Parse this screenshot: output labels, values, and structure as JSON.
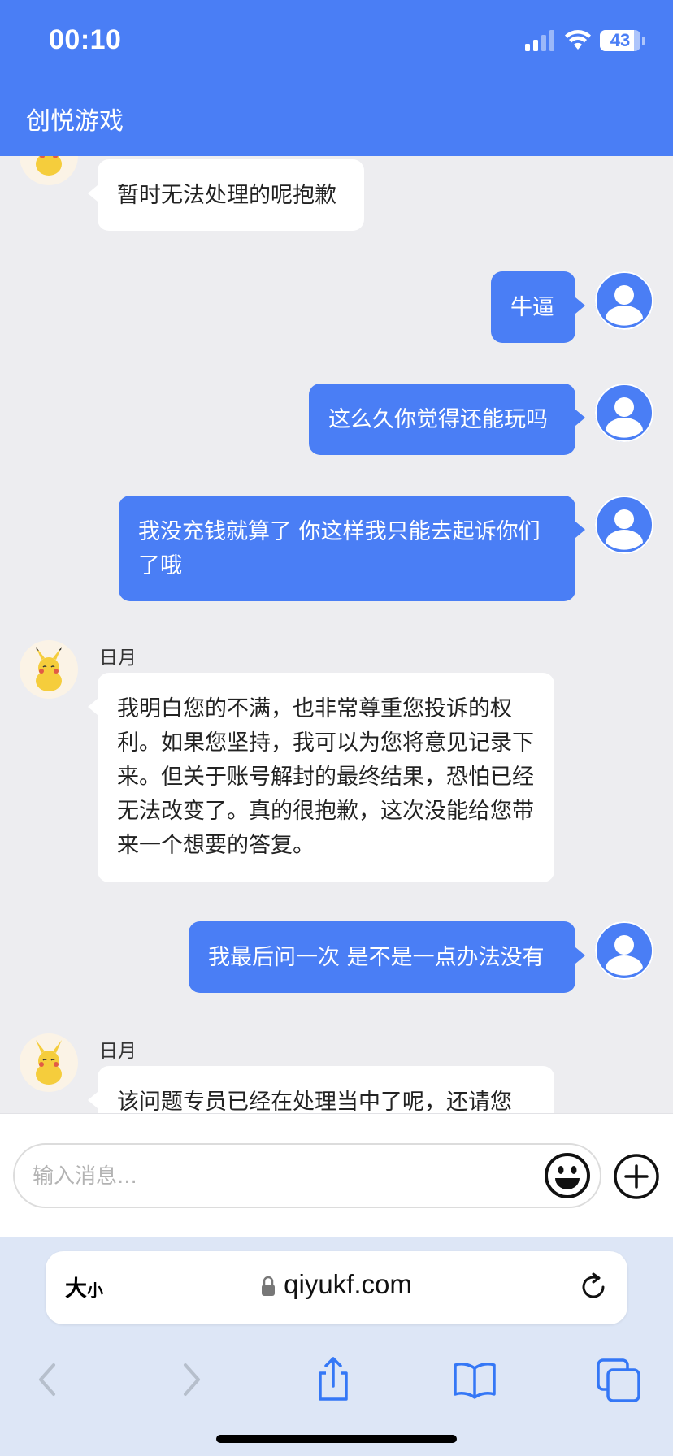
{
  "status_bar": {
    "time": "00:10",
    "battery": "43"
  },
  "header": {
    "title": "创悦游戏"
  },
  "messages": [
    {
      "side": "left",
      "sender": "",
      "text": "暂时无法处理的呢抱歉"
    },
    {
      "side": "right",
      "text": "牛逼"
    },
    {
      "side": "right",
      "text": "这么久你觉得还能玩吗"
    },
    {
      "side": "right",
      "text": "我没充钱就算了 你这样我只能去起诉你们了哦"
    },
    {
      "side": "left",
      "sender": "日月",
      "text": "我明白您的不满，也非常尊重您投诉的权利。如果您坚持，我可以为您将意见记录下来。但关于账号解封的最终结果，恐怕已经无法改变了。真的很抱歉，这次没能给您带来一个想要的答复。"
    },
    {
      "side": "right",
      "text": "我最后问一次 是不是一点办法没有"
    },
    {
      "side": "left",
      "sender": "日月",
      "text": "该问题专员已经在处理当中了呢，还请您"
    }
  ],
  "input": {
    "placeholder": "输入消息..."
  },
  "safari": {
    "text_size_big": "大",
    "text_size_small": "小",
    "url": "qiyukf.com"
  },
  "colors": {
    "accent": "#4a7ef5",
    "chat_bg": "#ededf0"
  },
  "icons": [
    "signal-icon",
    "wifi-icon",
    "battery-icon",
    "user-avatar-icon",
    "bot-avatar-icon",
    "emoji-icon",
    "plus-icon",
    "lock-icon",
    "reload-icon",
    "back-icon",
    "forward-icon",
    "share-icon",
    "bookmarks-icon",
    "tabs-icon"
  ]
}
